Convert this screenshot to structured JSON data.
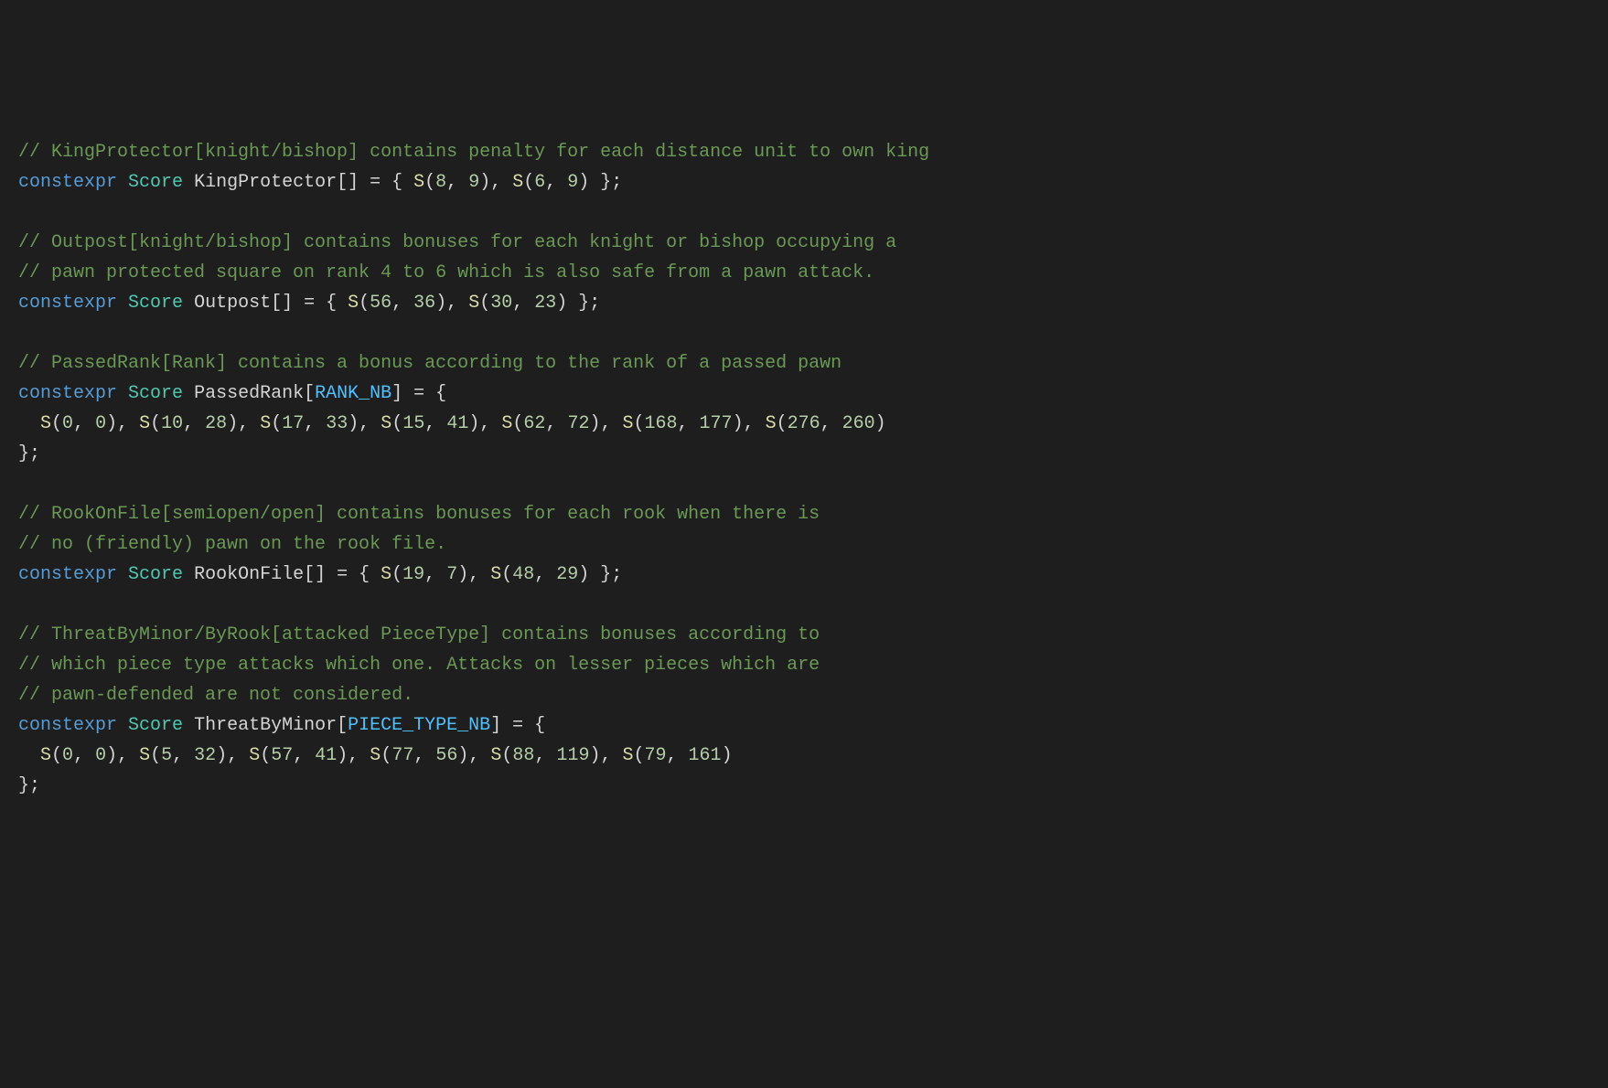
{
  "colors": {
    "background": "#1e1e1e",
    "comment": "#6a9955",
    "keyword": "#569cd6",
    "type": "#4ec9b0",
    "function": "#dcdcaa",
    "number": "#b5cea8",
    "constant": "#4fc1ff",
    "default": "#d4d4d4"
  },
  "code": {
    "comment1": "// KingProtector[knight/bishop] contains penalty for each distance unit to own king",
    "kw": "constexpr",
    "ty": "Score",
    "decl1_name": "KingProtector",
    "S": "S",
    "kp_v1a": "8",
    "kp_v1b": "9",
    "kp_v2a": "6",
    "kp_v2b": "9",
    "comment2a": "// Outpost[knight/bishop] contains bonuses for each knight or bishop occupying a",
    "comment2b": "// pawn protected square on rank 4 to 6 which is also safe from a pawn attack.",
    "decl2_name": "Outpost",
    "op_v1a": "56",
    "op_v1b": "36",
    "op_v2a": "30",
    "op_v2b": "23",
    "comment3": "// PassedRank[Rank] contains a bonus according to the rank of a passed pawn",
    "decl3_name": "PassedRank",
    "const_rank": "RANK_NB",
    "pr_v1a": "0",
    "pr_v1b": "0",
    "pr_v2a": "10",
    "pr_v2b": "28",
    "pr_v3a": "17",
    "pr_v3b": "33",
    "pr_v4a": "15",
    "pr_v4b": "41",
    "pr_v5a": "62",
    "pr_v5b": "72",
    "pr_v6a": "168",
    "pr_v6b": "177",
    "pr_v7a": "276",
    "pr_v7b": "260",
    "comment4a": "// RookOnFile[semiopen/open] contains bonuses for each rook when there is",
    "comment4b": "// no (friendly) pawn on the rook file.",
    "decl4_name": "RookOnFile",
    "rf_v1a": "19",
    "rf_v1b": "7",
    "rf_v2a": "48",
    "rf_v2b": "29",
    "comment5a": "// ThreatByMinor/ByRook[attacked PieceType] contains bonuses according to",
    "comment5b": "// which piece type attacks which one. Attacks on lesser pieces which are",
    "comment5c": "// pawn-defended are not considered.",
    "decl5_name": "ThreatByMinor",
    "const_piece": "PIECE_TYPE_NB",
    "tm_v1a": "0",
    "tm_v1b": "0",
    "tm_v2a": "5",
    "tm_v2b": "32",
    "tm_v3a": "57",
    "tm_v3b": "41",
    "tm_v4a": "77",
    "tm_v4b": "56",
    "tm_v5a": "88",
    "tm_v5b": "119",
    "tm_v6a": "79",
    "tm_v6b": "161"
  }
}
